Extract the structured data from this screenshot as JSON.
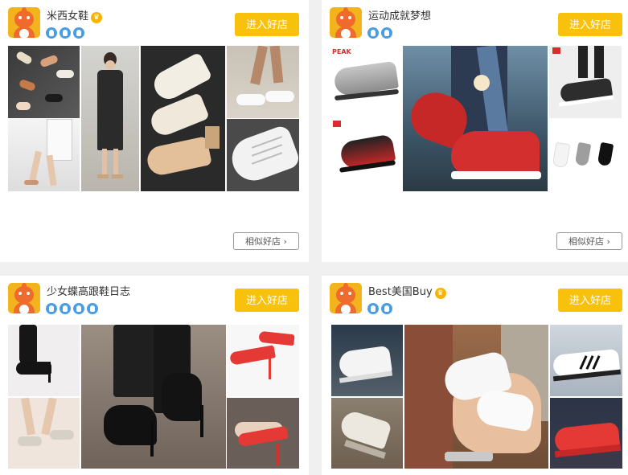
{
  "shops": [
    {
      "name": "米西女鞋",
      "has_crown": true,
      "badge_count": 3,
      "enter_label": "进入好店",
      "similar_label": "相似好店 ›"
    },
    {
      "name": "运动成就梦想",
      "has_crown": false,
      "badge_count": 2,
      "enter_label": "进入好店",
      "similar_label": "相似好店 ›",
      "brand_label": "PEAK"
    },
    {
      "name": "少女蝶高跟鞋日志",
      "has_crown": false,
      "badge_count": 4,
      "enter_label": "进入好店"
    },
    {
      "name": "Best美国Buy",
      "has_crown": true,
      "badge_count": 2,
      "enter_label": "进入好店"
    }
  ],
  "colors": {
    "accent": "#f8c10c",
    "badge": "#4a9de4",
    "avatar_bg": "#f2b31c",
    "mascot": "#ef6a2d"
  }
}
